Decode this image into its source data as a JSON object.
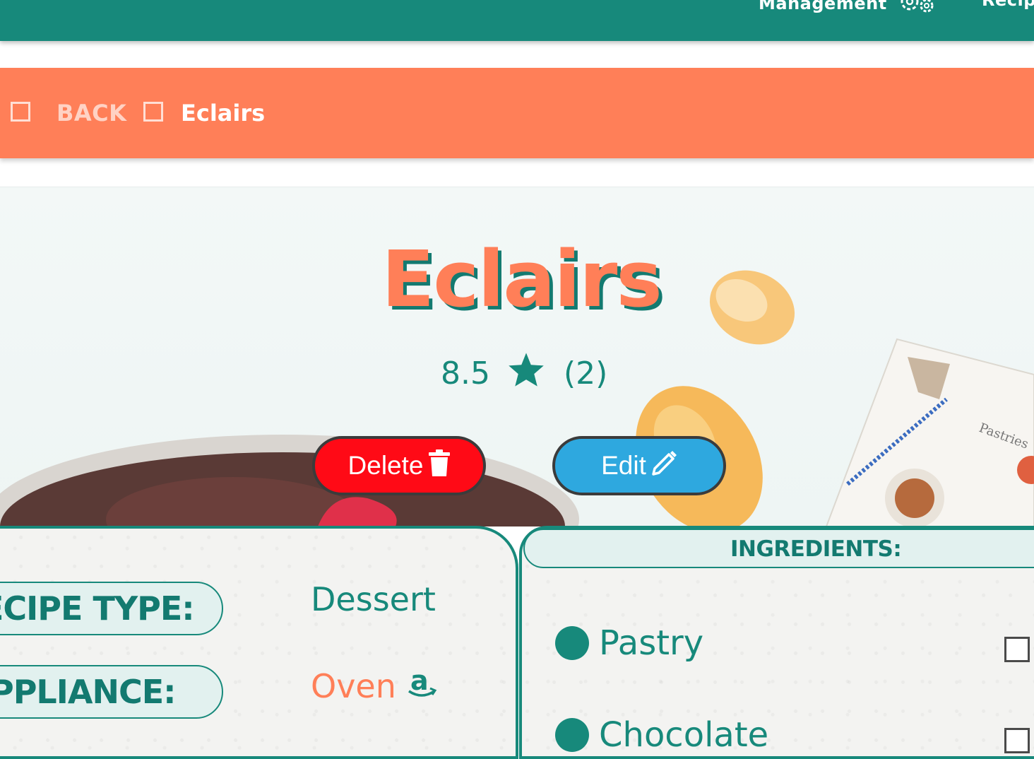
{
  "nav": {
    "management_label": "Management",
    "recipes_label": "Recip"
  },
  "breadcrumb": {
    "back_label": "BACK",
    "current_label": "Eclairs"
  },
  "recipe": {
    "title": "Eclairs",
    "rating_value": "8.5",
    "rating_count": "(2)",
    "delete_label": "Delete",
    "edit_label": "Edit"
  },
  "details": {
    "recipe_type_label": "ECIPE TYPE:",
    "recipe_type_value": "Dessert",
    "appliance_label": "PPLIANCE:",
    "appliance_value": "Oven"
  },
  "ingredients": {
    "header": "INGREDIENTS:",
    "items": [
      {
        "name": "Pastry"
      },
      {
        "name": "Chocolate"
      }
    ]
  },
  "colors": {
    "teal": "#17897b",
    "coral": "#ff7f58",
    "delete_red": "#ff0a16",
    "edit_blue": "#2ea8df"
  },
  "icons": [
    "cogs-icon",
    "trash-icon",
    "pencil-icon",
    "star-icon",
    "amazon-icon",
    "checkbox-icon"
  ]
}
